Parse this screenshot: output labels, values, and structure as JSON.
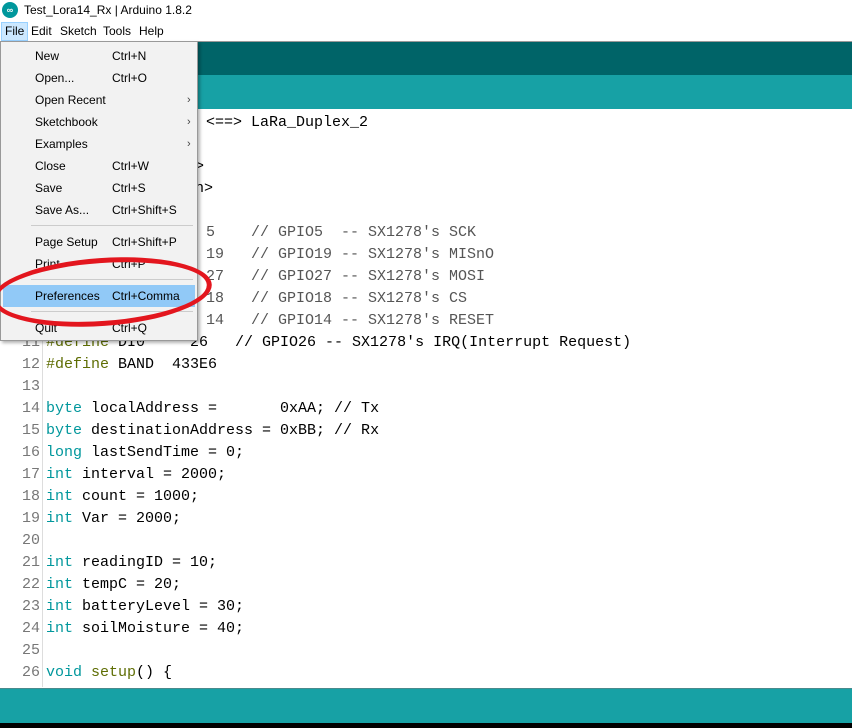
{
  "window": {
    "title": "Test_Lora14_Rx | Arduino 1.8.2",
    "logo": "arduino-logo-icon"
  },
  "menubar": {
    "items": [
      "File",
      "Edit",
      "Sketch",
      "Tools",
      "Help"
    ],
    "active": "File"
  },
  "file_menu": {
    "items": [
      {
        "label": "New",
        "shortcut": "Ctrl+N"
      },
      {
        "label": "Open...",
        "shortcut": "Ctrl+O"
      },
      {
        "label": "Open Recent",
        "shortcut": "",
        "submenu": true
      },
      {
        "label": "Sketchbook",
        "shortcut": "",
        "submenu": true
      },
      {
        "label": "Examples",
        "shortcut": "",
        "submenu": true
      },
      {
        "label": "Close",
        "shortcut": "Ctrl+W"
      },
      {
        "label": "Save",
        "shortcut": "Ctrl+S"
      },
      {
        "label": "Save As...",
        "shortcut": "Ctrl+Shift+S"
      },
      {
        "label": "Page Setup",
        "shortcut": "Ctrl+Shift+P"
      },
      {
        "label": "Print",
        "shortcut": "Ctrl+P"
      },
      {
        "label": "Preferences",
        "shortcut": "Ctrl+Comma",
        "highlighted": true
      },
      {
        "label": "Quit",
        "shortcut": "Ctrl+Q"
      }
    ],
    "submenu_arrow": "›"
  },
  "annotation": {
    "circle_color": "#e3161e",
    "circled_item": "Preferences"
  },
  "colors": {
    "toolbar": "#006468",
    "tabbar": "#17a1a5",
    "keyword": "#00979c",
    "preprocessor": "#5e6d03"
  },
  "code": {
    "visible_fragments": [
      {
        "text": "<==> LaRa_Duplex_2"
      },
      {
        "text": ">"
      },
      {
        "text": "h>"
      },
      {
        "text": "5    // GPIO5  -- SX1278's SCK"
      },
      {
        "text": "19   // GPIO19 -- SX1278's MISnO"
      },
      {
        "text": "27   // GPIO27 -- SX1278's MOSI"
      },
      {
        "text": "18   // GPIO18 -- SX1278's CS"
      },
      {
        "text": "14   // GPIO14 -- SX1278's RESET"
      }
    ],
    "lines": [
      {
        "n": "11",
        "kw": "#define",
        "kwtype": "pre",
        "rest": " DI0     26   // GPIO26 -- SX1278's IRQ(Interrupt Request)"
      },
      {
        "n": "12",
        "kw": "#define",
        "kwtype": "pre",
        "rest": " BAND  433E6"
      },
      {
        "n": "13",
        "kw": "",
        "kwtype": "",
        "rest": ""
      },
      {
        "n": "14",
        "kw": "byte",
        "kwtype": "type",
        "rest": " localAddress =       0xAA; // Tx"
      },
      {
        "n": "15",
        "kw": "byte",
        "kwtype": "type",
        "rest": " destinationAddress = 0xBB; // Rx"
      },
      {
        "n": "16",
        "kw": "long",
        "kwtype": "type",
        "rest": " lastSendTime = 0;"
      },
      {
        "n": "17",
        "kw": "int",
        "kwtype": "type",
        "rest": " interval = 2000;"
      },
      {
        "n": "18",
        "kw": "int",
        "kwtype": "type",
        "rest": " count = 1000;"
      },
      {
        "n": "19",
        "kw": "int",
        "kwtype": "type",
        "rest": " Var = 2000;"
      },
      {
        "n": "20",
        "kw": "",
        "kwtype": "",
        "rest": ""
      },
      {
        "n": "21",
        "kw": "int",
        "kwtype": "type",
        "rest": " readingID = 10;"
      },
      {
        "n": "22",
        "kw": "int",
        "kwtype": "type",
        "rest": " tempC = 20;"
      },
      {
        "n": "23",
        "kw": "int",
        "kwtype": "type",
        "rest": " batteryLevel = 30;"
      },
      {
        "n": "24",
        "kw": "int",
        "kwtype": "type",
        "rest": " soilMoisture = 40;"
      },
      {
        "n": "25",
        "kw": "",
        "kwtype": "",
        "rest": ""
      },
      {
        "n": "26",
        "kw": "void",
        "kwtype": "type",
        "rest": " ",
        "fn": "setup",
        "tail": "() {"
      }
    ]
  }
}
